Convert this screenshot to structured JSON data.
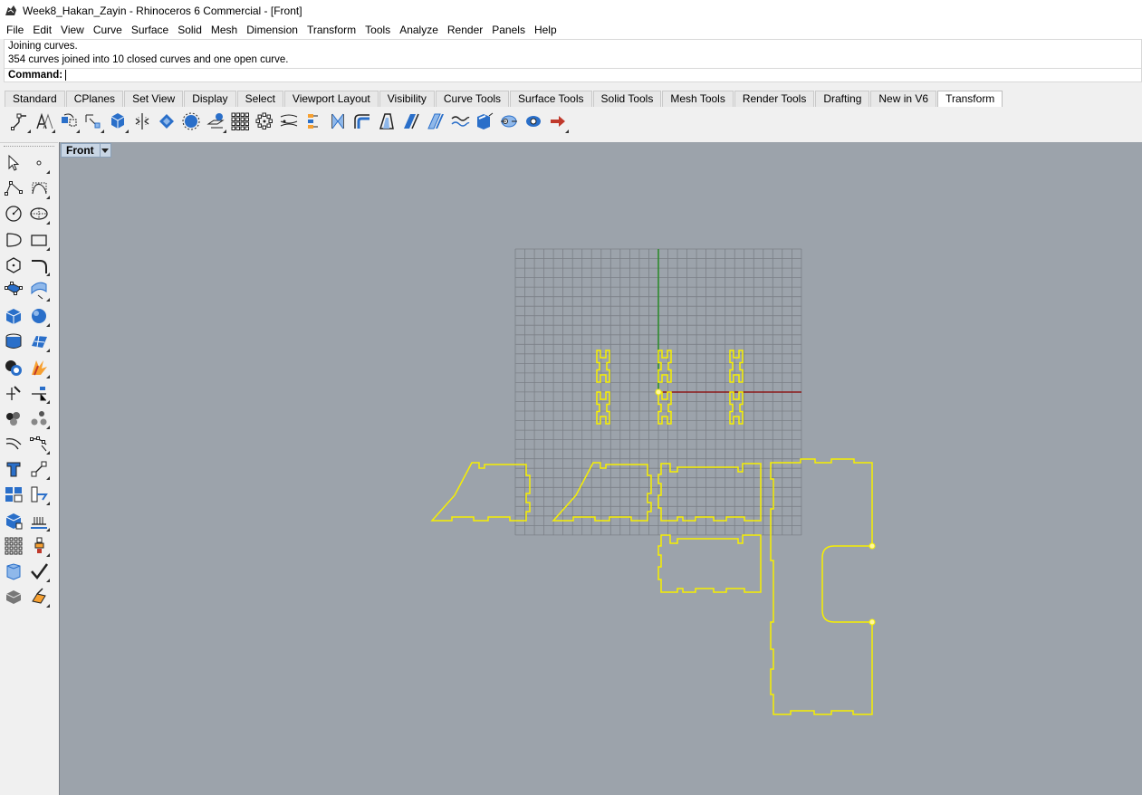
{
  "window": {
    "title": "Week8_Hakan_Zayin - Rhinoceros 6 Commercial - [Front]"
  },
  "menu": [
    "File",
    "Edit",
    "View",
    "Curve",
    "Surface",
    "Solid",
    "Mesh",
    "Dimension",
    "Transform",
    "Tools",
    "Analyze",
    "Render",
    "Panels",
    "Help"
  ],
  "command": {
    "history": [
      "Joining curves.",
      "354 curves joined into 10 closed curves and one open curve."
    ],
    "prompt": "Command:",
    "value": ""
  },
  "toolbar_tabs": [
    "Standard",
    "CPlanes",
    "Set View",
    "Display",
    "Select",
    "Viewport Layout",
    "Visibility",
    "Curve Tools",
    "Surface Tools",
    "Solid Tools",
    "Mesh Tools",
    "Render Tools",
    "Drafting",
    "New in V6",
    "Transform"
  ],
  "active_tab": "Transform",
  "transform_tools": [
    {
      "icon": "move-icon",
      "flyout": true
    },
    {
      "icon": "copy-icon",
      "flyout": true
    },
    {
      "icon": "rotate-icon",
      "flyout": true
    },
    {
      "icon": "scale-icon",
      "flyout": true
    },
    {
      "icon": "mirror-icon",
      "flyout": true
    },
    {
      "icon": "orient-icon",
      "flyout": false
    },
    {
      "icon": "align-icon",
      "flyout": false
    },
    {
      "icon": "set-points-icon",
      "flyout": false
    },
    {
      "icon": "project-icon",
      "flyout": true
    },
    {
      "icon": "array-icon",
      "flyout": false
    },
    {
      "icon": "array-polar-icon",
      "flyout": false
    },
    {
      "icon": "twist-icon",
      "flyout": false
    },
    {
      "icon": "bend-icon",
      "flyout": false
    },
    {
      "icon": "taper-icon",
      "flyout": false
    },
    {
      "icon": "flow-icon",
      "flyout": false
    },
    {
      "icon": "shear-icon",
      "flyout": false
    },
    {
      "icon": "smash-icon",
      "flyout": false
    },
    {
      "icon": "cage-edit-icon",
      "flyout": false
    },
    {
      "icon": "splop-icon",
      "flyout": false
    },
    {
      "icon": "stretch-icon",
      "flyout": false
    },
    {
      "icon": "maelstrom-icon",
      "flyout": false
    },
    {
      "icon": "sporph-icon",
      "flyout": false
    },
    {
      "icon": "arrange-icon",
      "flyout": true
    }
  ],
  "sidebar_tools": [
    "select-arrow-icon",
    "point-icon",
    "polyline-icon",
    "curve-icon",
    "circle-icon",
    "ellipse-icon",
    "arc-icon",
    "rectangle-icon",
    "polygon-icon",
    "fillet-curve-icon",
    "surface-corner-icon",
    "extrude-curve-icon",
    "box-icon",
    "sphere-icon",
    "cylinder-icon",
    "patch-icon",
    "boolean-union-icon",
    "explode-icon",
    "trim-icon",
    "split-icon",
    "group-icon",
    "ungroup-icon",
    "offset-icon",
    "rebuild-icon",
    "text-icon",
    "dimension-icon",
    "layout-icon",
    "blocks-icon",
    "solid-edit-icon",
    "hatch-icon",
    "points-on-icon",
    "gumball-icon",
    "cage-icon",
    "check-icon",
    "shade-icon",
    "render-icon"
  ],
  "viewport": {
    "name": "Front",
    "background": "#9ca3ab",
    "grid_color": "#7b8087",
    "curve_color": "#f7f000",
    "x_axis_color": "#8b1a1a",
    "y_axis_color": "#2e8b2e"
  }
}
